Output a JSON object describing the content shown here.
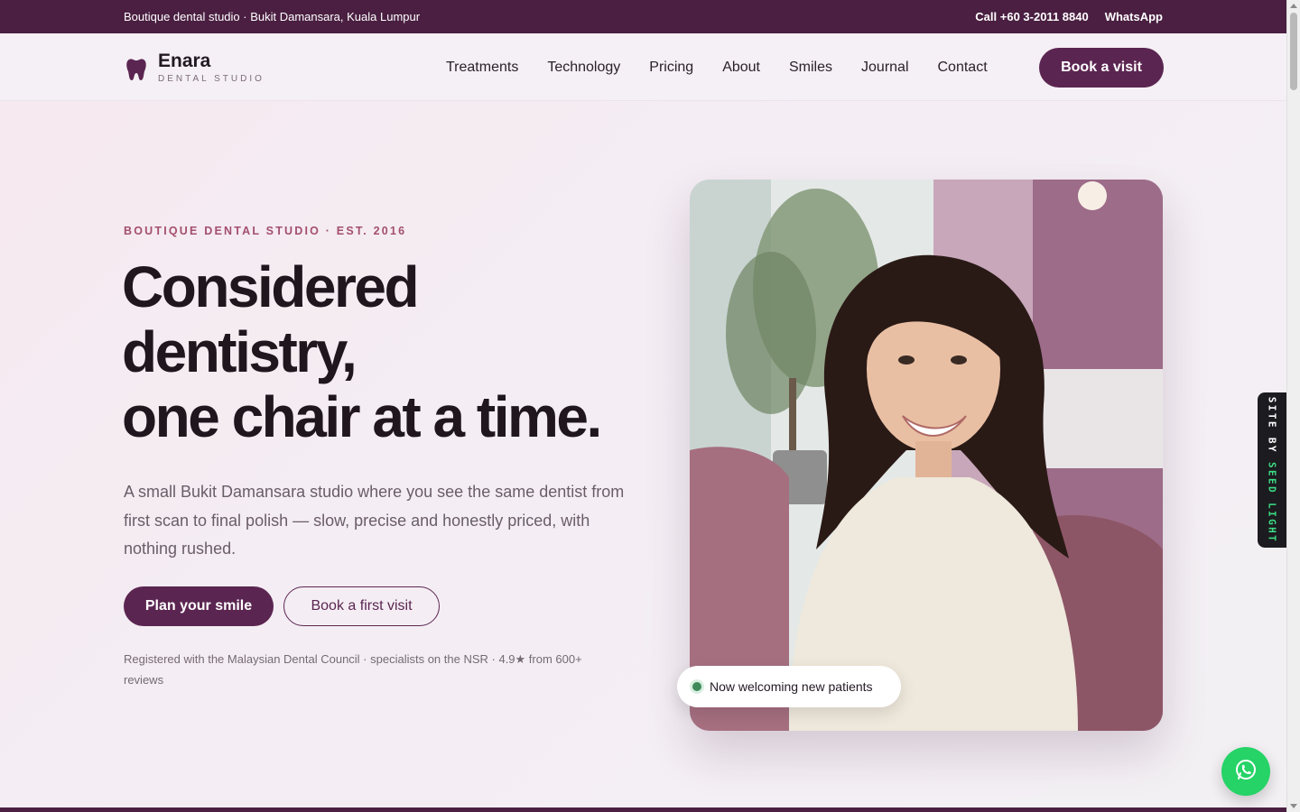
{
  "topbar": {
    "location": "Boutique dental studio · Bukit Damansara, Kuala Lumpur",
    "phone": "Call +60 3-2011 8840",
    "whatsapp": "WhatsApp"
  },
  "header": {
    "brand_name": "Enara",
    "brand_tagline": "DENTAL STUDIO",
    "nav": [
      "Treatments",
      "Technology",
      "Pricing",
      "About",
      "Smiles",
      "Journal",
      "Contact"
    ],
    "cta": "Book a visit"
  },
  "hero": {
    "eyebrow": "BOUTIQUE DENTAL STUDIO · EST. 2016",
    "headline_lines": [
      "Considered",
      "dentistry,",
      "one chair at a time."
    ],
    "lead": "A small Bukit Damansara studio where you see the same dentist from first scan to final polish — slow, precise and honestly priced, with nothing rushed.",
    "primary_cta": "Plan your smile",
    "secondary_cta": "Book a first visit",
    "trust_line": "Registered with the Malaysian Dental Council · specialists on the NSR · 4.9★ from 600+ reviews",
    "badge": "Now welcoming new patients"
  },
  "site_tab": {
    "prefix": "SITE BY ",
    "accent": "SEED LIGHT"
  },
  "colors": {
    "brand": "#5b2551",
    "topbar": "#4a1f41",
    "eyebrow": "#a34f6e",
    "status_dot": "#3f8a5b",
    "whatsapp": "#25d366"
  },
  "icons": {
    "logo": "tooth-icon",
    "status": "status-dot-icon",
    "chat": "whatsapp-icon"
  }
}
